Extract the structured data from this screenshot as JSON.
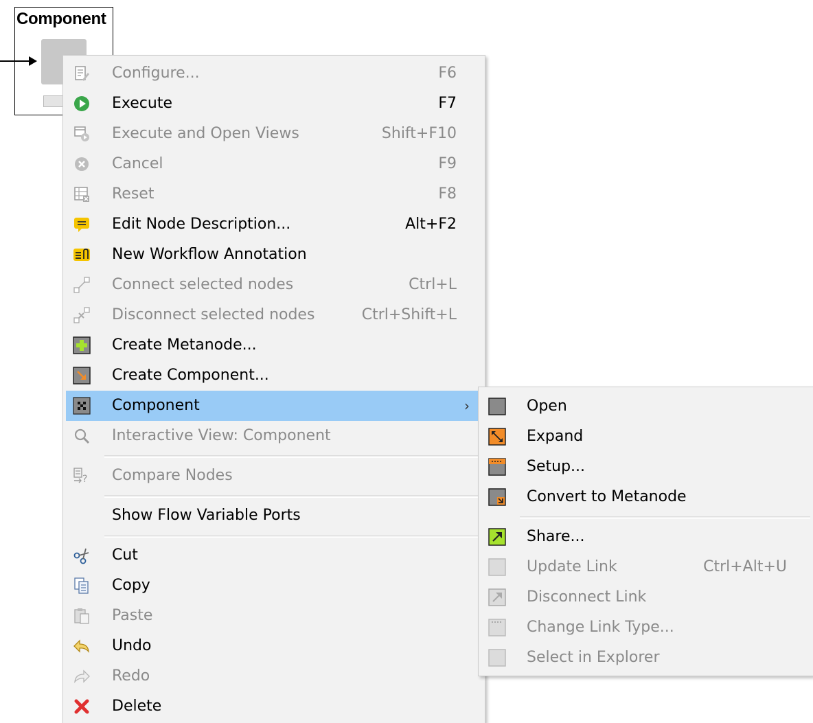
{
  "node": {
    "title": "Component"
  },
  "menu": {
    "items": [
      {
        "label": "Configure...",
        "shortcut": "F6",
        "enabled": false,
        "icon": "configure-icon"
      },
      {
        "label": "Execute",
        "shortcut": "F7",
        "enabled": true,
        "icon": "execute-icon"
      },
      {
        "label": "Execute and Open Views",
        "shortcut": "Shift+F10",
        "enabled": false,
        "icon": "execute-open-views-icon"
      },
      {
        "label": "Cancel",
        "shortcut": "F9",
        "enabled": false,
        "icon": "cancel-icon"
      },
      {
        "label": "Reset",
        "shortcut": "F8",
        "enabled": false,
        "icon": "reset-icon"
      },
      {
        "label": "Edit Node Description...",
        "shortcut": "Alt+F2",
        "enabled": true,
        "icon": "edit-description-icon"
      },
      {
        "label": "New Workflow Annotation",
        "shortcut": "",
        "enabled": true,
        "icon": "new-annotation-icon"
      },
      {
        "label": "Connect selected nodes",
        "shortcut": "Ctrl+L",
        "enabled": false,
        "icon": "connect-nodes-icon"
      },
      {
        "label": "Disconnect selected nodes",
        "shortcut": "Ctrl+Shift+L",
        "enabled": false,
        "icon": "disconnect-nodes-icon"
      },
      {
        "label": "Create Metanode...",
        "shortcut": "",
        "enabled": true,
        "icon": "create-metanode-icon"
      },
      {
        "label": "Create Component...",
        "shortcut": "",
        "enabled": true,
        "icon": "create-component-icon"
      },
      {
        "label": "Component",
        "shortcut": "",
        "enabled": true,
        "icon": "component-icon",
        "submenu": true
      },
      {
        "label": "Interactive View: Component",
        "shortcut": "",
        "enabled": false,
        "icon": "magnifier-icon"
      },
      {
        "label": "Compare Nodes",
        "shortcut": "",
        "enabled": false,
        "icon": "compare-nodes-icon"
      },
      {
        "label": "Show Flow Variable Ports",
        "shortcut": "",
        "enabled": true,
        "icon": ""
      },
      {
        "label": "Cut",
        "shortcut": "",
        "enabled": true,
        "icon": "scissors-icon"
      },
      {
        "label": "Copy",
        "shortcut": "",
        "enabled": true,
        "icon": "copy-icon"
      },
      {
        "label": "Paste",
        "shortcut": "",
        "enabled": false,
        "icon": "paste-icon"
      },
      {
        "label": "Undo",
        "shortcut": "",
        "enabled": true,
        "icon": "undo-icon"
      },
      {
        "label": "Redo",
        "shortcut": "",
        "enabled": false,
        "icon": "redo-icon"
      },
      {
        "label": "Delete",
        "shortcut": "",
        "enabled": true,
        "icon": "delete-icon"
      }
    ]
  },
  "submenu": {
    "items": [
      {
        "label": "Open",
        "shortcut": "",
        "enabled": true,
        "icon": "open-component-icon"
      },
      {
        "label": "Expand",
        "shortcut": "",
        "enabled": true,
        "icon": "expand-icon"
      },
      {
        "label": "Setup...",
        "shortcut": "",
        "enabled": true,
        "icon": "setup-icon"
      },
      {
        "label": "Convert to Metanode",
        "shortcut": "",
        "enabled": true,
        "icon": "convert-to-metanode-icon"
      },
      {
        "label": "Share...",
        "shortcut": "",
        "enabled": true,
        "icon": "share-icon"
      },
      {
        "label": "Update Link",
        "shortcut": "Ctrl+Alt+U",
        "enabled": false,
        "icon": "update-link-icon"
      },
      {
        "label": "Disconnect Link",
        "shortcut": "",
        "enabled": false,
        "icon": "disconnect-link-icon"
      },
      {
        "label": "Change Link Type...",
        "shortcut": "",
        "enabled": false,
        "icon": "change-link-type-icon"
      },
      {
        "label": "Select in Explorer",
        "shortcut": "",
        "enabled": false,
        "icon": "select-in-explorer-icon"
      }
    ]
  },
  "colors": {
    "highlight": "#99cbf6",
    "menu_background": "#f2f2f2",
    "disabled_text": "#8a8a8a",
    "execute_green": "#3aa64a",
    "annotation_yellow": "#f5c400",
    "component_orange": "#f28c28",
    "delete_red": "#e03030"
  }
}
